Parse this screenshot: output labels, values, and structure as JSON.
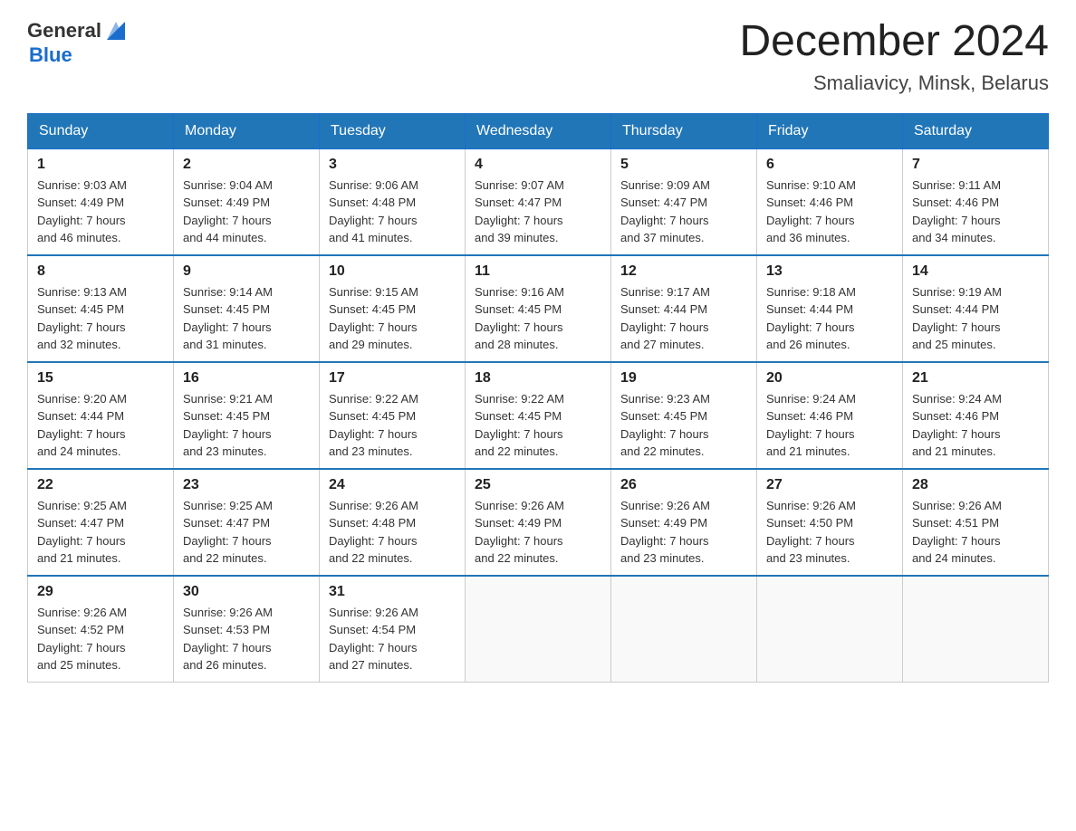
{
  "logo": {
    "general": "General",
    "blue": "Blue"
  },
  "title": "December 2024",
  "location": "Smaliavicy, Minsk, Belarus",
  "days_of_week": [
    "Sunday",
    "Monday",
    "Tuesday",
    "Wednesday",
    "Thursday",
    "Friday",
    "Saturday"
  ],
  "weeks": [
    [
      {
        "day": "1",
        "sunrise": "9:03 AM",
        "sunset": "4:49 PM",
        "daylight": "7 hours and 46 minutes."
      },
      {
        "day": "2",
        "sunrise": "9:04 AM",
        "sunset": "4:49 PM",
        "daylight": "7 hours and 44 minutes."
      },
      {
        "day": "3",
        "sunrise": "9:06 AM",
        "sunset": "4:48 PM",
        "daylight": "7 hours and 41 minutes."
      },
      {
        "day": "4",
        "sunrise": "9:07 AM",
        "sunset": "4:47 PM",
        "daylight": "7 hours and 39 minutes."
      },
      {
        "day": "5",
        "sunrise": "9:09 AM",
        "sunset": "4:47 PM",
        "daylight": "7 hours and 37 minutes."
      },
      {
        "day": "6",
        "sunrise": "9:10 AM",
        "sunset": "4:46 PM",
        "daylight": "7 hours and 36 minutes."
      },
      {
        "day": "7",
        "sunrise": "9:11 AM",
        "sunset": "4:46 PM",
        "daylight": "7 hours and 34 minutes."
      }
    ],
    [
      {
        "day": "8",
        "sunrise": "9:13 AM",
        "sunset": "4:45 PM",
        "daylight": "7 hours and 32 minutes."
      },
      {
        "day": "9",
        "sunrise": "9:14 AM",
        "sunset": "4:45 PM",
        "daylight": "7 hours and 31 minutes."
      },
      {
        "day": "10",
        "sunrise": "9:15 AM",
        "sunset": "4:45 PM",
        "daylight": "7 hours and 29 minutes."
      },
      {
        "day": "11",
        "sunrise": "9:16 AM",
        "sunset": "4:45 PM",
        "daylight": "7 hours and 28 minutes."
      },
      {
        "day": "12",
        "sunrise": "9:17 AM",
        "sunset": "4:44 PM",
        "daylight": "7 hours and 27 minutes."
      },
      {
        "day": "13",
        "sunrise": "9:18 AM",
        "sunset": "4:44 PM",
        "daylight": "7 hours and 26 minutes."
      },
      {
        "day": "14",
        "sunrise": "9:19 AM",
        "sunset": "4:44 PM",
        "daylight": "7 hours and 25 minutes."
      }
    ],
    [
      {
        "day": "15",
        "sunrise": "9:20 AM",
        "sunset": "4:44 PM",
        "daylight": "7 hours and 24 minutes."
      },
      {
        "day": "16",
        "sunrise": "9:21 AM",
        "sunset": "4:45 PM",
        "daylight": "7 hours and 23 minutes."
      },
      {
        "day": "17",
        "sunrise": "9:22 AM",
        "sunset": "4:45 PM",
        "daylight": "7 hours and 23 minutes."
      },
      {
        "day": "18",
        "sunrise": "9:22 AM",
        "sunset": "4:45 PM",
        "daylight": "7 hours and 22 minutes."
      },
      {
        "day": "19",
        "sunrise": "9:23 AM",
        "sunset": "4:45 PM",
        "daylight": "7 hours and 22 minutes."
      },
      {
        "day": "20",
        "sunrise": "9:24 AM",
        "sunset": "4:46 PM",
        "daylight": "7 hours and 21 minutes."
      },
      {
        "day": "21",
        "sunrise": "9:24 AM",
        "sunset": "4:46 PM",
        "daylight": "7 hours and 21 minutes."
      }
    ],
    [
      {
        "day": "22",
        "sunrise": "9:25 AM",
        "sunset": "4:47 PM",
        "daylight": "7 hours and 21 minutes."
      },
      {
        "day": "23",
        "sunrise": "9:25 AM",
        "sunset": "4:47 PM",
        "daylight": "7 hours and 22 minutes."
      },
      {
        "day": "24",
        "sunrise": "9:26 AM",
        "sunset": "4:48 PM",
        "daylight": "7 hours and 22 minutes."
      },
      {
        "day": "25",
        "sunrise": "9:26 AM",
        "sunset": "4:49 PM",
        "daylight": "7 hours and 22 minutes."
      },
      {
        "day": "26",
        "sunrise": "9:26 AM",
        "sunset": "4:49 PM",
        "daylight": "7 hours and 23 minutes."
      },
      {
        "day": "27",
        "sunrise": "9:26 AM",
        "sunset": "4:50 PM",
        "daylight": "7 hours and 23 minutes."
      },
      {
        "day": "28",
        "sunrise": "9:26 AM",
        "sunset": "4:51 PM",
        "daylight": "7 hours and 24 minutes."
      }
    ],
    [
      {
        "day": "29",
        "sunrise": "9:26 AM",
        "sunset": "4:52 PM",
        "daylight": "7 hours and 25 minutes."
      },
      {
        "day": "30",
        "sunrise": "9:26 AM",
        "sunset": "4:53 PM",
        "daylight": "7 hours and 26 minutes."
      },
      {
        "day": "31",
        "sunrise": "9:26 AM",
        "sunset": "4:54 PM",
        "daylight": "7 hours and 27 minutes."
      },
      null,
      null,
      null,
      null
    ]
  ],
  "labels": {
    "sunrise": "Sunrise:",
    "sunset": "Sunset:",
    "daylight": "Daylight:"
  }
}
